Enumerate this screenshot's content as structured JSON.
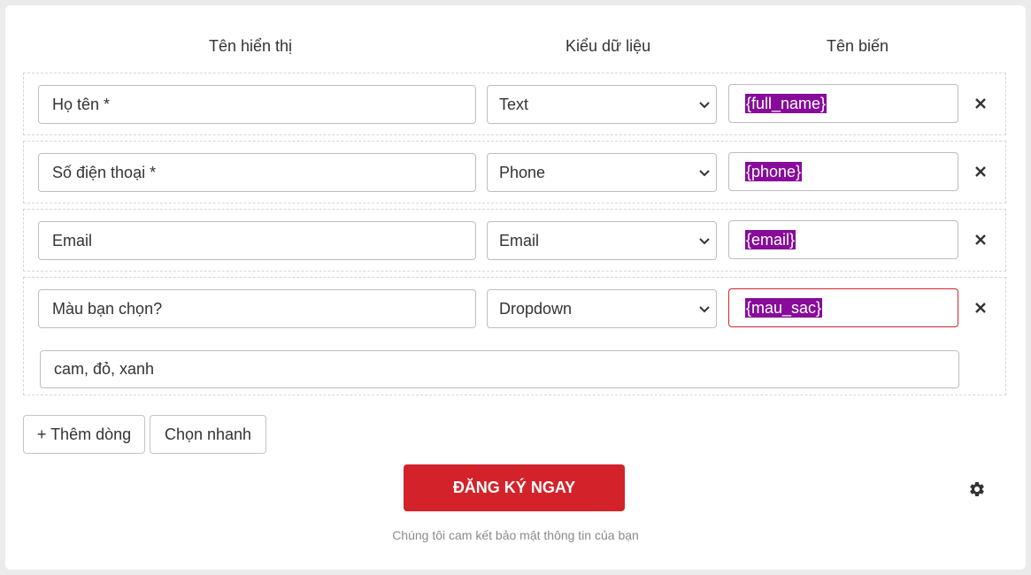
{
  "headers": {
    "display_name": "Tên hiển thị",
    "data_type": "Kiểu dữ liệu",
    "variable_name": "Tên biến"
  },
  "rows": [
    {
      "label": "Họ tên *",
      "type": "Text",
      "variable": "{full_name}"
    },
    {
      "label": "Số điện thoại *",
      "type": "Phone",
      "variable": "{phone}"
    },
    {
      "label": "Email",
      "type": "Email",
      "variable": "{email}"
    },
    {
      "label": "Màu bạn chọn?",
      "type": "Dropdown",
      "variable": "{mau_sac}",
      "options": "cam, đỏ, xanh"
    }
  ],
  "actions": {
    "add_row": "+ Thêm dòng",
    "quick_pick": "Chọn nhanh"
  },
  "submit_label": "ĐĂNG KÝ NGAY",
  "privacy_note": "Chúng tôi cam kết bảo mật thông tin của bạn",
  "colors": {
    "accent_red": "#d3222a",
    "variable_highlight": "#860c99",
    "error_border": "#d2232a"
  },
  "icons": {
    "remove": "close-icon",
    "select": "chevron-down-icon",
    "settings": "gear-icon"
  }
}
